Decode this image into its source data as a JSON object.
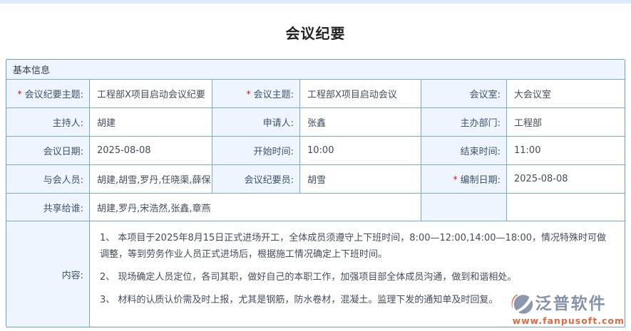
{
  "page": {
    "title": "会议纪要"
  },
  "panel": {
    "header": "基本信息"
  },
  "form": {
    "required_marker": "*",
    "rows": [
      {
        "cells": [
          {
            "label": "会议纪要主题:",
            "required": true,
            "value": "工程部X项目启动会议纪要"
          },
          {
            "label": "会议主题:",
            "required": true,
            "value": "工程部X项目启动会议"
          },
          {
            "label": "会议室:",
            "required": false,
            "value": "大会议室"
          }
        ]
      },
      {
        "cells": [
          {
            "label": "主持人:",
            "required": false,
            "value": "胡建"
          },
          {
            "label": "申请人:",
            "required": false,
            "value": "张鑫"
          },
          {
            "label": "主办部门:",
            "required": false,
            "value": "工程部"
          }
        ]
      },
      {
        "cells": [
          {
            "label": "会议日期:",
            "required": false,
            "value": "2025-08-08"
          },
          {
            "label": "开始时间:",
            "required": false,
            "value": "10:00"
          },
          {
            "label": "结束时间:",
            "required": false,
            "value": "11:00"
          }
        ]
      },
      {
        "cells": [
          {
            "label": "与会人员:",
            "required": false,
            "value": "胡建,胡雪,罗丹,任晓渠,薛保"
          },
          {
            "label": "会议纪要员:",
            "required": false,
            "value": "胡雪"
          },
          {
            "label": "编制日期:",
            "required": true,
            "value": "2025-08-08"
          }
        ]
      }
    ],
    "share_row": {
      "label": "共享给谁:",
      "value": "胡建,罗丹,宋浩然,张鑫,章燕"
    },
    "content_row": {
      "label": "内容:",
      "paragraphs": [
        "1、 本项目于2025年8月15日正式进场开工，全体成员须遵守上下班时间，8:00—12:00,14:00—18:00，情况特殊时可做调整，等到劳务作业人员正式进场后，根据施工情况确定上下班时间。",
        "2、 现场确定人员定位，各司其职，做好自己的本职工作，加强项目部全体成员沟通，做到和谐相处。",
        "3、 材料的认质认价需及时上报，尤其是钢筋，防水卷材，混凝土。监理下发的通知单及时回复。"
      ]
    }
  },
  "colors": {
    "border_blue": "#74a9d8",
    "label_bg": "#eef5fd",
    "top_strip": "#dde9f8",
    "required_red": "#e60012",
    "label_text": "#3a536e",
    "value_text": "#414d5c",
    "watermark_brand": "#8593a9",
    "watermark_url": "#e2693f"
  },
  "watermark": {
    "brand": "泛普软件",
    "url": "www.fanpusoft.com"
  }
}
